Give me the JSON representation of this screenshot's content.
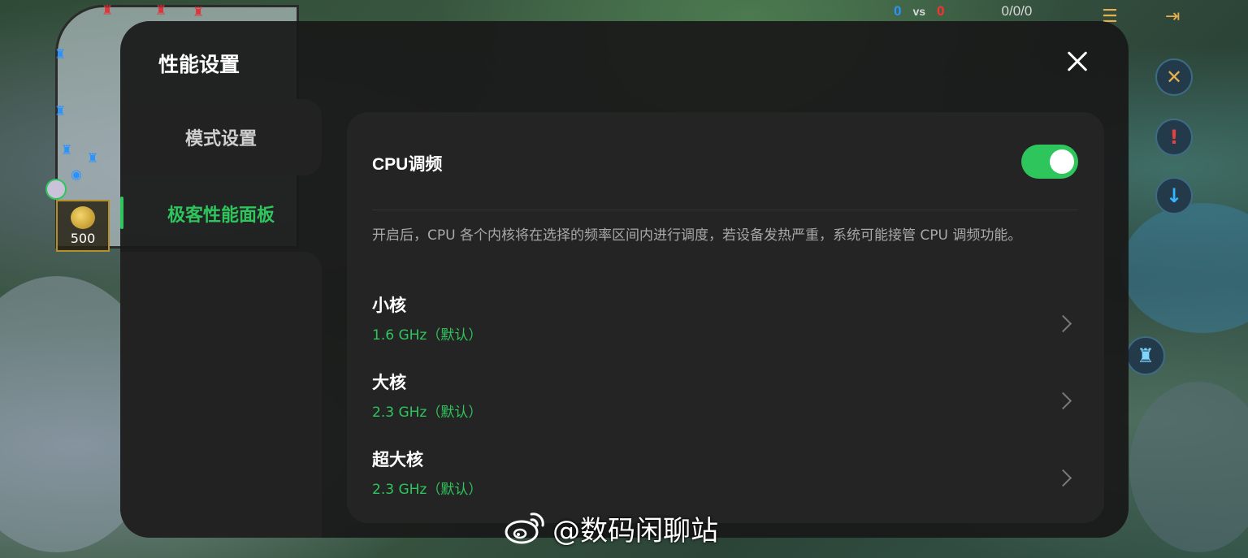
{
  "game_hud": {
    "score_blue": "0",
    "score_vs": "vs",
    "score_red": "0",
    "kda": "0/0/0",
    "gold": "500",
    "menu_icon": "list-icon",
    "exit_icon": "exit-icon"
  },
  "panel": {
    "title": "性能设置",
    "close_icon": "close-icon"
  },
  "sidebar": {
    "items": [
      {
        "label": "模式设置",
        "active": false
      },
      {
        "label": "极客性能面板",
        "active": true
      }
    ]
  },
  "cpu": {
    "title": "CPU调频",
    "toggle_on": true,
    "description": "开启后，CPU 各个内核将在选择的频率区间内进行调度，若设备发热严重，系统可能接管 CPU 调频功能。",
    "cores": [
      {
        "name": "小核",
        "freq": "1.6 GHz（默认）"
      },
      {
        "name": "大核",
        "freq": "2.3 GHz（默认）"
      },
      {
        "name": "超大核",
        "freq": "2.3 GHz（默认）"
      }
    ]
  },
  "watermark": {
    "text": "@数码闲聊站",
    "logo_icon": "weibo-logo-icon"
  },
  "colors": {
    "accent_green": "#2ec55d",
    "panel_bg": "#191919",
    "card_bg": "#242424"
  }
}
